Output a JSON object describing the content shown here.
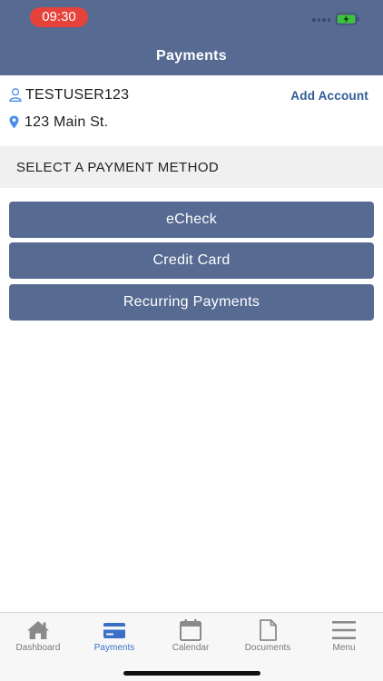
{
  "status_bar": {
    "time": "09:30",
    "icons": [
      "signal-dots-icon",
      "battery-charging-icon"
    ]
  },
  "header": {
    "title": "Payments"
  },
  "account": {
    "username": "TESTUSER123",
    "address": "123 Main St.",
    "add_account_label": "Add Account"
  },
  "section": {
    "title": "SELECT A PAYMENT METHOD"
  },
  "payment_methods": [
    {
      "label": "eCheck"
    },
    {
      "label": "Credit Card"
    },
    {
      "label": "Recurring Payments"
    }
  ],
  "tabbar": {
    "active": "Payments",
    "items": [
      {
        "label": "Dashboard",
        "icon": "home-icon"
      },
      {
        "label": "Payments",
        "icon": "credit-card-icon"
      },
      {
        "label": "Calendar",
        "icon": "calendar-icon"
      },
      {
        "label": "Documents",
        "icon": "document-icon"
      },
      {
        "label": "Menu",
        "icon": "hamburger-menu-icon"
      }
    ]
  },
  "colors": {
    "header_bg": "#566a92",
    "button_bg": "#566a92",
    "time_pill": "#e5423a",
    "link": "#2f5b96",
    "active_tab": "#3a6fc9",
    "inactive_tab": "#7a7a7a",
    "icon_blue": "#4a8fe7",
    "battery_green": "#3ac63a"
  }
}
